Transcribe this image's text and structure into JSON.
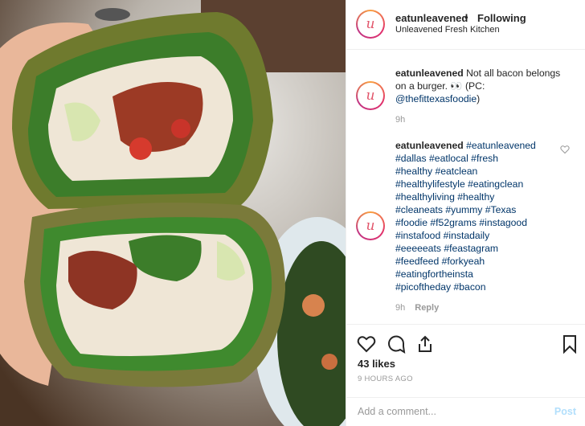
{
  "post": {
    "username": "eatunleavened",
    "follow_state": "Following",
    "location": "Unleavened Fresh Kitchen",
    "avatar_glyph": "u"
  },
  "caption": {
    "username": "eatunleavened",
    "text": "Not all bacon belongs on a burger. 👀 (PC:",
    "mention": "@thefittexasfoodie",
    "closing": ")",
    "time": "9h"
  },
  "hashtag_comment": {
    "username": "eatunleavened",
    "first_tag": "#eatunleavened",
    "lines": [
      "#dallas #eatlocal #fresh",
      "#healthy #eatclean",
      "#healthylifestyle #eatingclean",
      "#healthyliving #healthy",
      "#cleaneats #yummy #Texas",
      "#foodie #f52grams #instagood",
      "#instafood #instadaily",
      "#eeeeeats #feastagram",
      "#feedfeed #forkyeah",
      "#eatingfortheinsta",
      "#picoftheday #bacon"
    ],
    "time": "9h",
    "reply_label": "Reply"
  },
  "engagement": {
    "likes": "43 likes",
    "time_ago": "9 HOURS AGO"
  },
  "composer": {
    "placeholder": "Add a comment...",
    "post_label": "Post"
  },
  "icons": {
    "like": "heart-icon",
    "comment": "comment-icon",
    "share": "share-icon",
    "save": "bookmark-icon",
    "comment_like": "heart-small-icon"
  },
  "colors": {
    "link": "#003569",
    "muted": "#999999",
    "post_disabled": "#b2dffc",
    "avatar_ring": "#e1306c"
  }
}
